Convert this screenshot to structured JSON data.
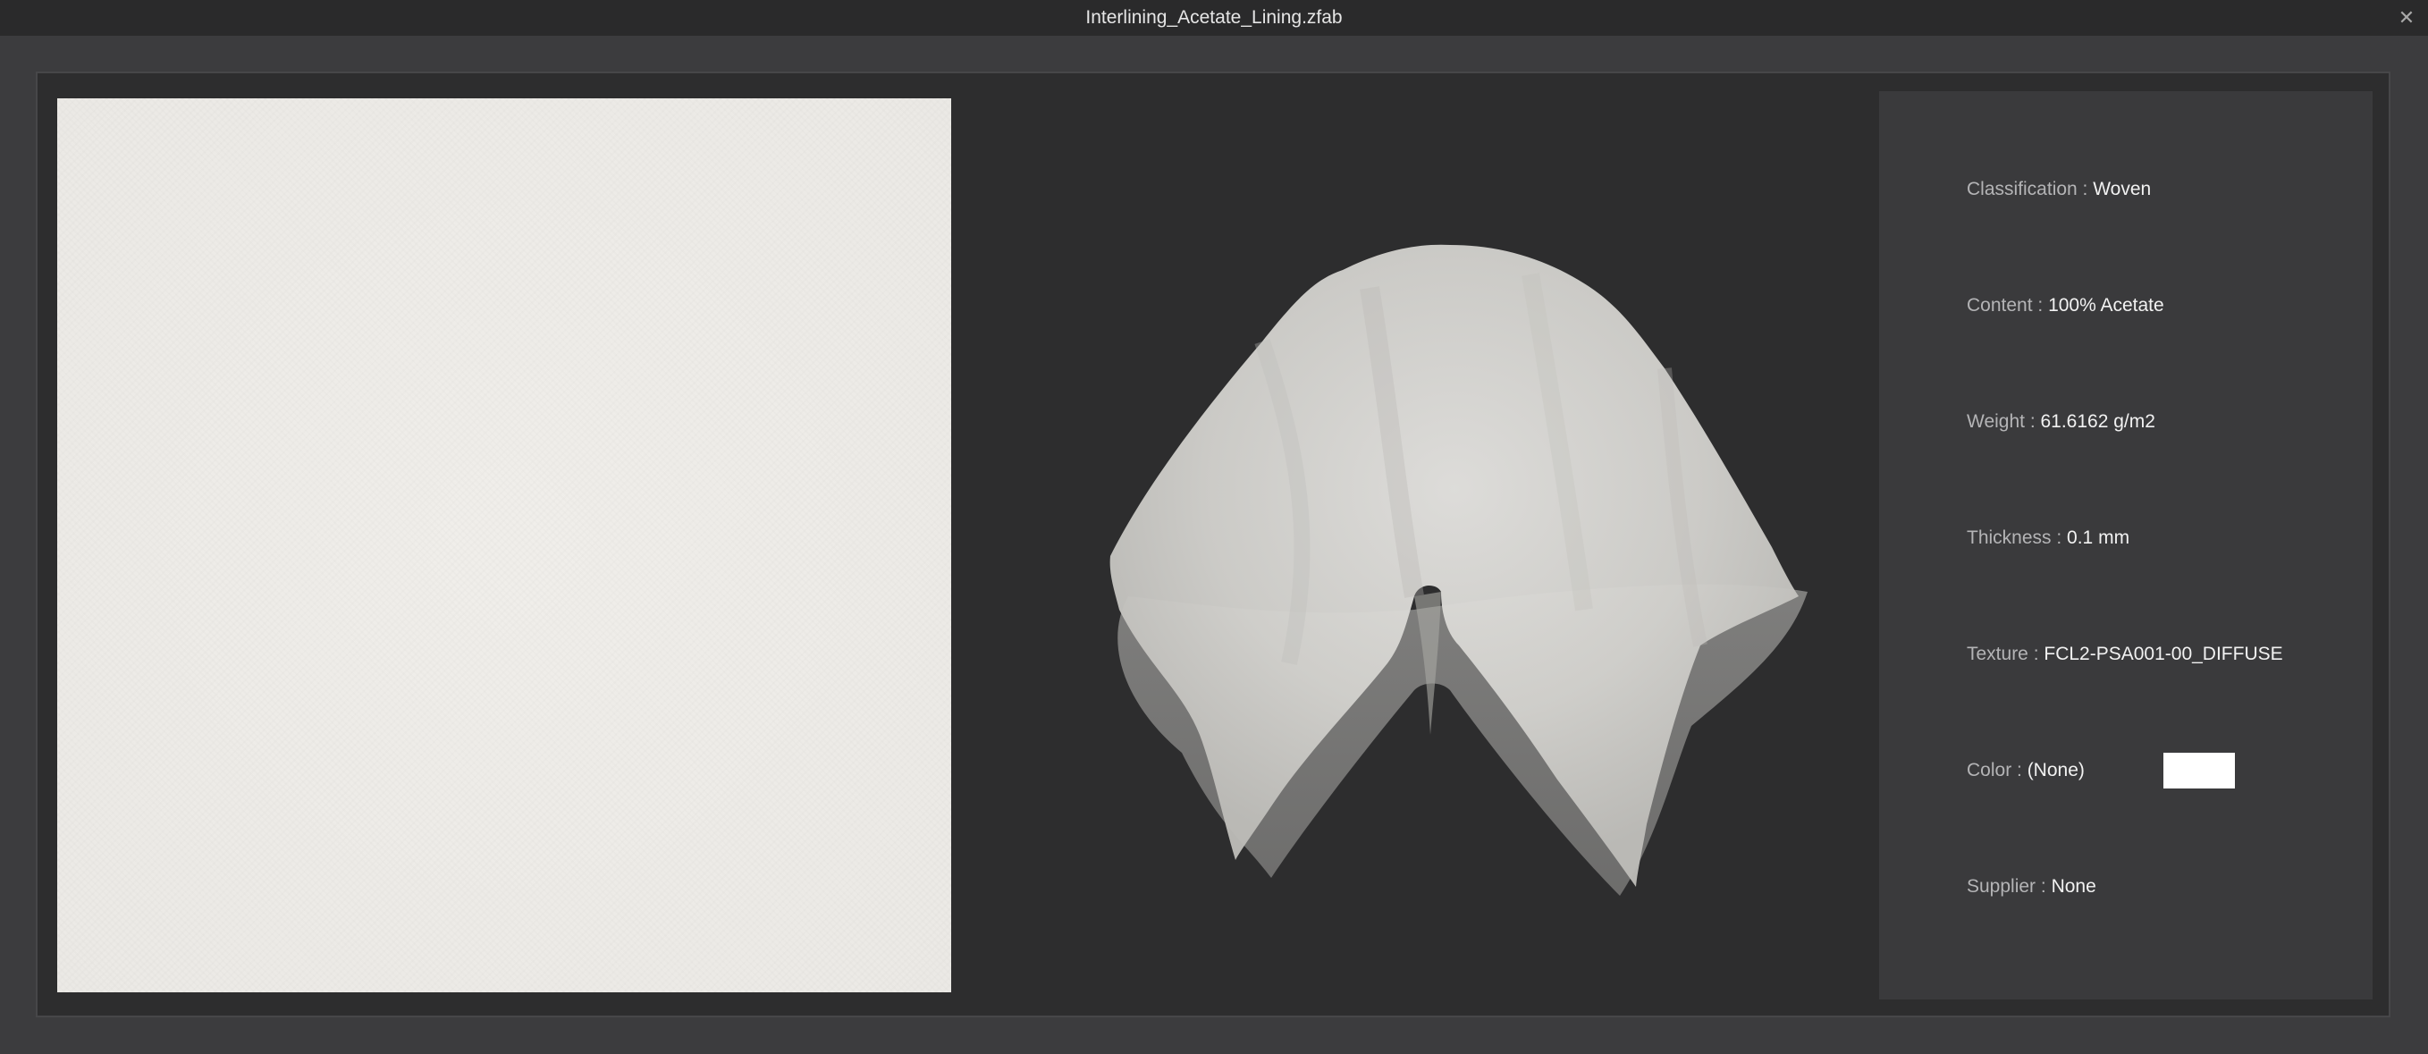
{
  "window": {
    "title": "Interlining_Acetate_Lining.zfab",
    "close_glyph": "✕"
  },
  "info": {
    "classification": {
      "label": "Classification : ",
      "value": "Woven"
    },
    "content": {
      "label": "Content : ",
      "value": "100% Acetate"
    },
    "weight": {
      "label": "Weight : ",
      "value": "61.6162 g/m2"
    },
    "thickness": {
      "label": "Thickness : ",
      "value": "0.1 mm"
    },
    "texture": {
      "label": "Texture : ",
      "value": "FCL2-PSA001-00_DIFFUSE"
    },
    "color": {
      "label": "Color : ",
      "value": "(None)",
      "swatch": "#ffffff"
    },
    "supplier": {
      "label": "Supplier : ",
      "value": "None"
    }
  },
  "colors": {
    "titlebar": "#2a2a2b",
    "background": "#3c3c3e",
    "viewport": "#2d2d2e",
    "panel": "#3a3a3c",
    "fabric": "#eeece8"
  },
  "icons": [
    "close-icon",
    "fabric-swatch",
    "fabric-drape-preview"
  ]
}
